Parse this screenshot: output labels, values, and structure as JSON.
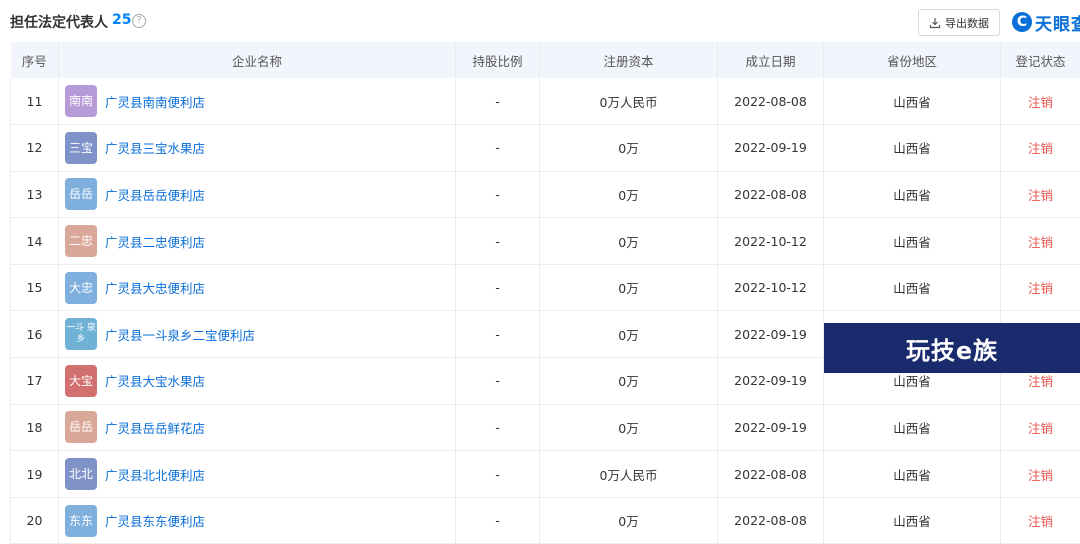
{
  "header": {
    "title": "担任法定代表人",
    "count": "25",
    "help_icon": "?",
    "export_label": "导出数据",
    "logo_text": "天眼查"
  },
  "table": {
    "columns": [
      "序号",
      "企业名称",
      "持股比例",
      "注册资本",
      "成立日期",
      "省份地区",
      "登记状态"
    ],
    "rows": [
      {
        "index": "11",
        "avatar": "南南",
        "avatar_color": "#b79ad8",
        "name": "广灵县南南便利店",
        "share": "-",
        "capital": "0万人民币",
        "date": "2022-08-08",
        "region": "山西省",
        "status": "注销"
      },
      {
        "index": "12",
        "avatar": "三宝",
        "avatar_color": "#7f93c9",
        "name": "广灵县三宝水果店",
        "share": "-",
        "capital": "0万",
        "date": "2022-09-19",
        "region": "山西省",
        "status": "注销"
      },
      {
        "index": "13",
        "avatar": "岳岳",
        "avatar_color": "#7fb0dd",
        "name": "广灵县岳岳便利店",
        "share": "-",
        "capital": "0万",
        "date": "2022-08-08",
        "region": "山西省",
        "status": "注销"
      },
      {
        "index": "14",
        "avatar": "二忠",
        "avatar_color": "#d9a898",
        "name": "广灵县二忠便利店",
        "share": "-",
        "capital": "0万",
        "date": "2022-10-12",
        "region": "山西省",
        "status": "注销"
      },
      {
        "index": "15",
        "avatar": "大忠",
        "avatar_color": "#7fb0dd",
        "name": "广灵县大忠便利店",
        "share": "-",
        "capital": "0万",
        "date": "2022-10-12",
        "region": "山西省",
        "status": "注销"
      },
      {
        "index": "16",
        "avatar": "一斗 泉乡",
        "avatar_color": "#6fb2d6",
        "name": "广灵县一斗泉乡二宝便利店",
        "share": "-",
        "capital": "0万",
        "date": "2022-09-19",
        "region": "",
        "status": ""
      },
      {
        "index": "17",
        "avatar": "大宝",
        "avatar_color": "#d26f6f",
        "name": "广灵县大宝水果店",
        "share": "-",
        "capital": "0万",
        "date": "2022-09-19",
        "region": "山西省",
        "status": "注销"
      },
      {
        "index": "18",
        "avatar": "岳岳",
        "avatar_color": "#d9a898",
        "name": "广灵县岳岳鲜花店",
        "share": "-",
        "capital": "0万",
        "date": "2022-09-19",
        "region": "山西省",
        "status": "注销"
      },
      {
        "index": "19",
        "avatar": "北北",
        "avatar_color": "#7f93c9",
        "name": "广灵县北北便利店",
        "share": "-",
        "capital": "0万人民币",
        "date": "2022-08-08",
        "region": "山西省",
        "status": "注销"
      },
      {
        "index": "20",
        "avatar": "东东",
        "avatar_color": "#7fb0dd",
        "name": "广灵县东东便利店",
        "share": "-",
        "capital": "0万",
        "date": "2022-08-08",
        "region": "山西省",
        "status": "注销"
      }
    ]
  },
  "overlay": {
    "text": "玩技e族",
    "color": "#1a2b6d"
  },
  "colors": {
    "link": "#0a6fd8",
    "accent": "#0084ff",
    "status_cancel": "#e8554e",
    "header_bg": "#f2f6fc"
  }
}
